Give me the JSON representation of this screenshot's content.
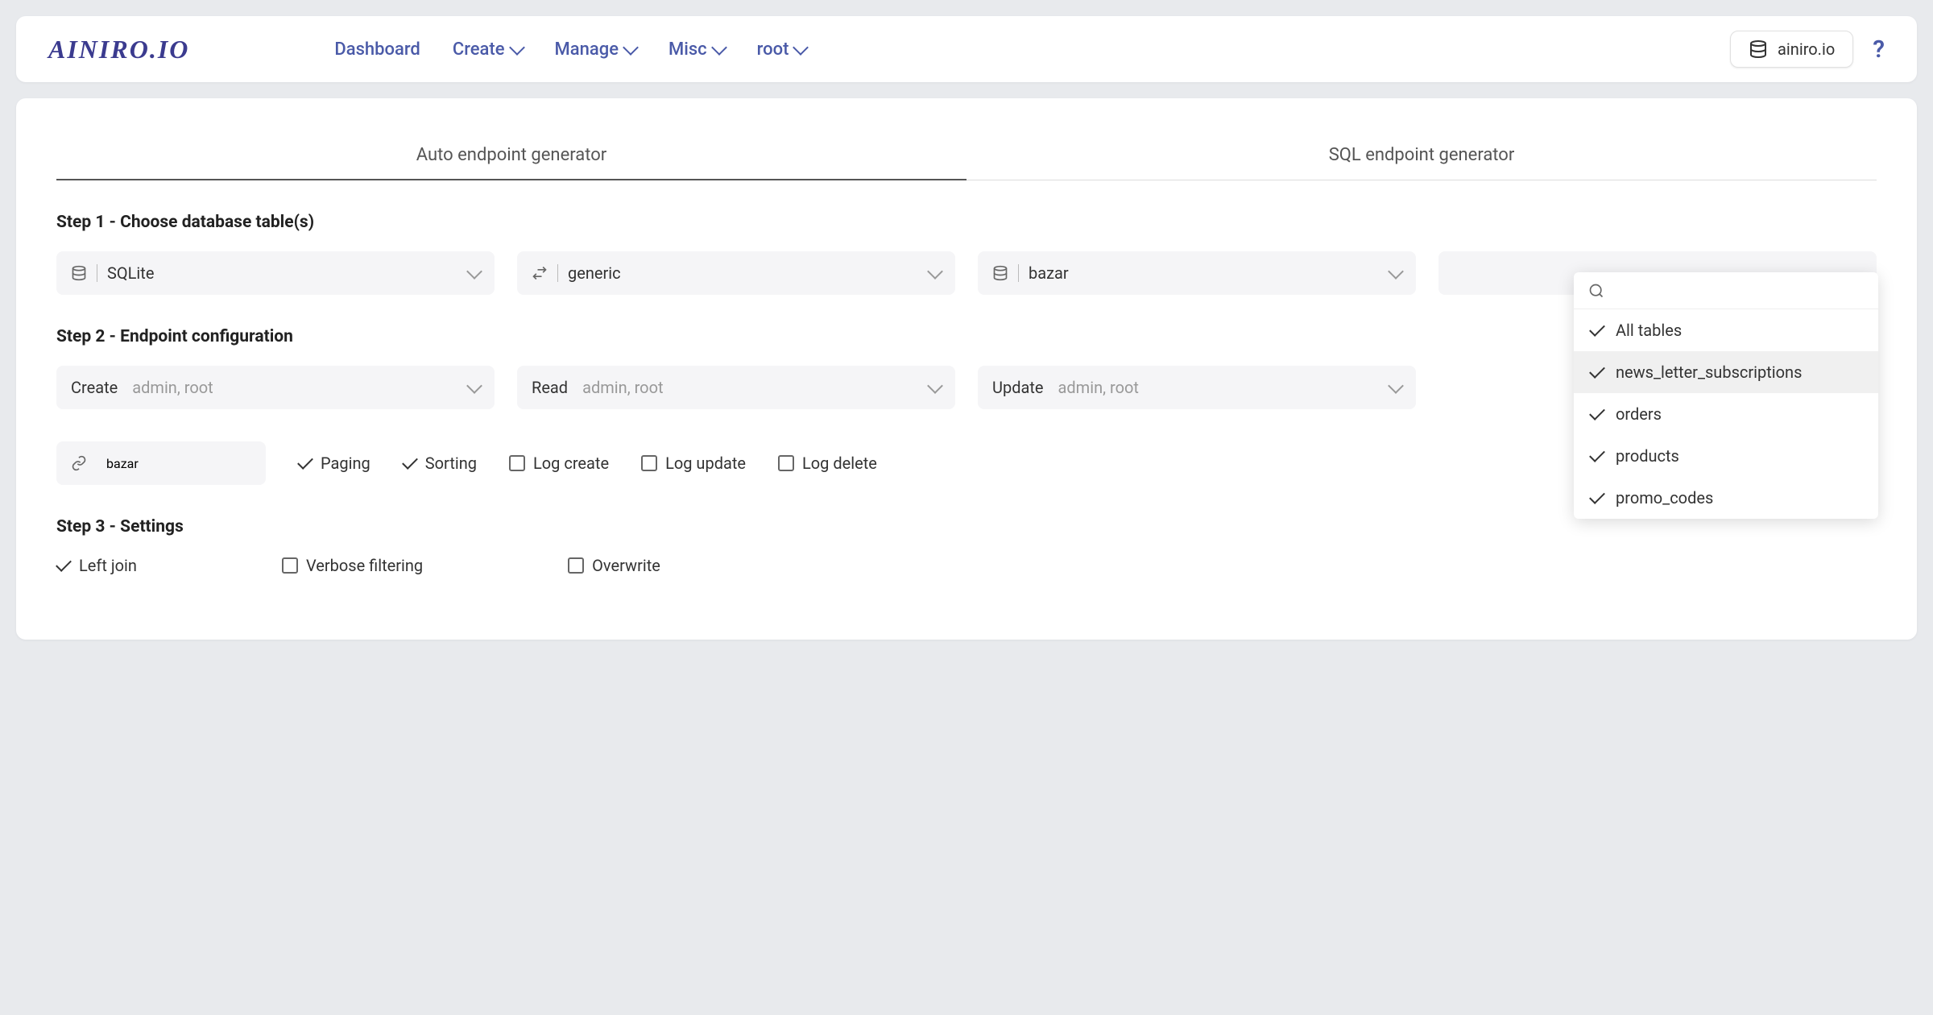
{
  "header": {
    "logo": "AINIRO.IO",
    "nav": {
      "dashboard": "Dashboard",
      "create": "Create",
      "manage": "Manage",
      "misc": "Misc",
      "root": "root"
    },
    "account": "ainiro.io",
    "help": "?"
  },
  "tabs": {
    "auto": "Auto endpoint generator",
    "sql": "SQL endpoint generator"
  },
  "step1": {
    "title": "Step 1 - Choose database table(s)",
    "db_type": "SQLite",
    "connection": "generic",
    "database": "bazar"
  },
  "tables_dropdown": {
    "search_placeholder": "",
    "items": {
      "all": "All tables",
      "news": "news_letter_subscriptions",
      "orders": "orders",
      "products": "products",
      "promo": "promo_codes"
    }
  },
  "step2": {
    "title": "Step 2 - Endpoint configuration",
    "create_label": "Create",
    "create_roles": "admin, root",
    "read_label": "Read",
    "read_roles": "admin, root",
    "update_label": "Update",
    "update_roles": "admin, root",
    "url_value": "bazar",
    "paging": "Paging",
    "sorting": "Sorting",
    "log_create": "Log create",
    "log_update": "Log update",
    "log_delete": "Log delete"
  },
  "step3": {
    "title": "Step 3 - Settings",
    "left_join": "Left join",
    "verbose": "Verbose filtering",
    "overwrite": "Overwrite"
  }
}
